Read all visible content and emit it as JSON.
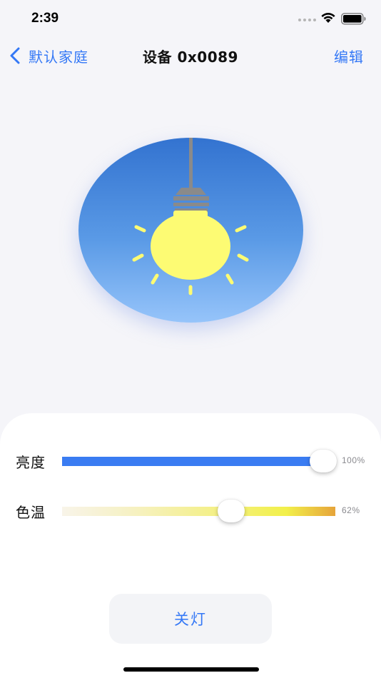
{
  "status_bar": {
    "time": "2:39"
  },
  "nav": {
    "back_label": "默认家庭",
    "title": "设备 0x0089",
    "edit_label": "编辑"
  },
  "colors": {
    "accent": "#3478f6",
    "bulb_glow": "#fdfb73",
    "disc_top": "#3373d0",
    "disc_bottom": "#96c4fa"
  },
  "controls": {
    "brightness": {
      "label": "亮度",
      "value_text": "100%",
      "level": 1.0
    },
    "color_temperature": {
      "label": "色温",
      "value_text": "62%",
      "level": 0.62
    }
  },
  "power_button": {
    "label": "关灯"
  },
  "icons": [
    "chevron-left-icon",
    "wifi-icon",
    "battery-icon",
    "light-bulb-icon"
  ]
}
